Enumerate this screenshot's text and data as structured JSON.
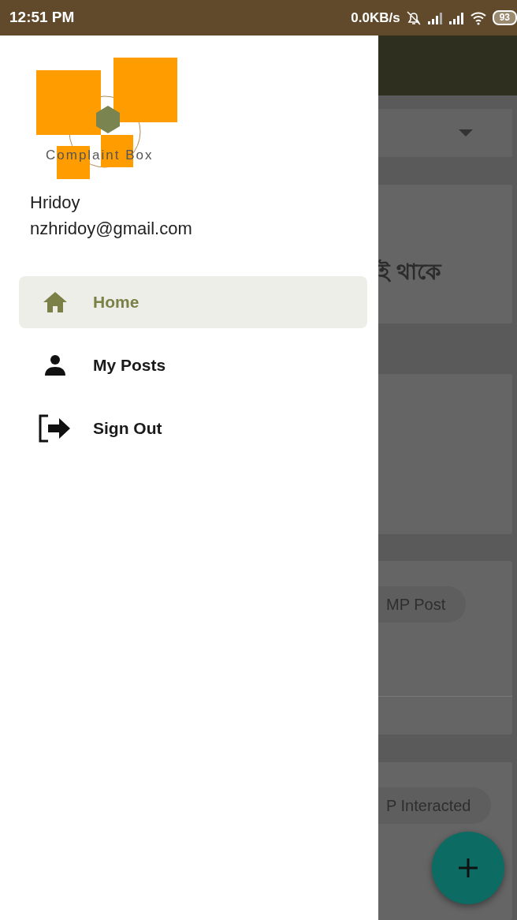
{
  "status_bar": {
    "time": "12:51 PM",
    "network_speed": "0.0KB/s",
    "battery": "93"
  },
  "drawer": {
    "logo_text": "Complaint Box",
    "user_name": "Hridoy",
    "user_email": "nzhridoy@gmail.com",
    "items": [
      {
        "label": "Home",
        "kind": "home",
        "selected": true
      },
      {
        "label": "My Posts",
        "kind": "person",
        "selected": false
      },
      {
        "label": "Sign Out",
        "kind": "exit",
        "selected": false
      }
    ]
  },
  "background": {
    "cards": [
      {
        "kind": "text",
        "text": "ই থাকে"
      },
      {
        "kind": "blank"
      },
      {
        "kind": "chip",
        "chip": "MP Post",
        "divider": true
      },
      {
        "kind": "chip",
        "chip": "P Interacted",
        "divider": false
      }
    ]
  }
}
